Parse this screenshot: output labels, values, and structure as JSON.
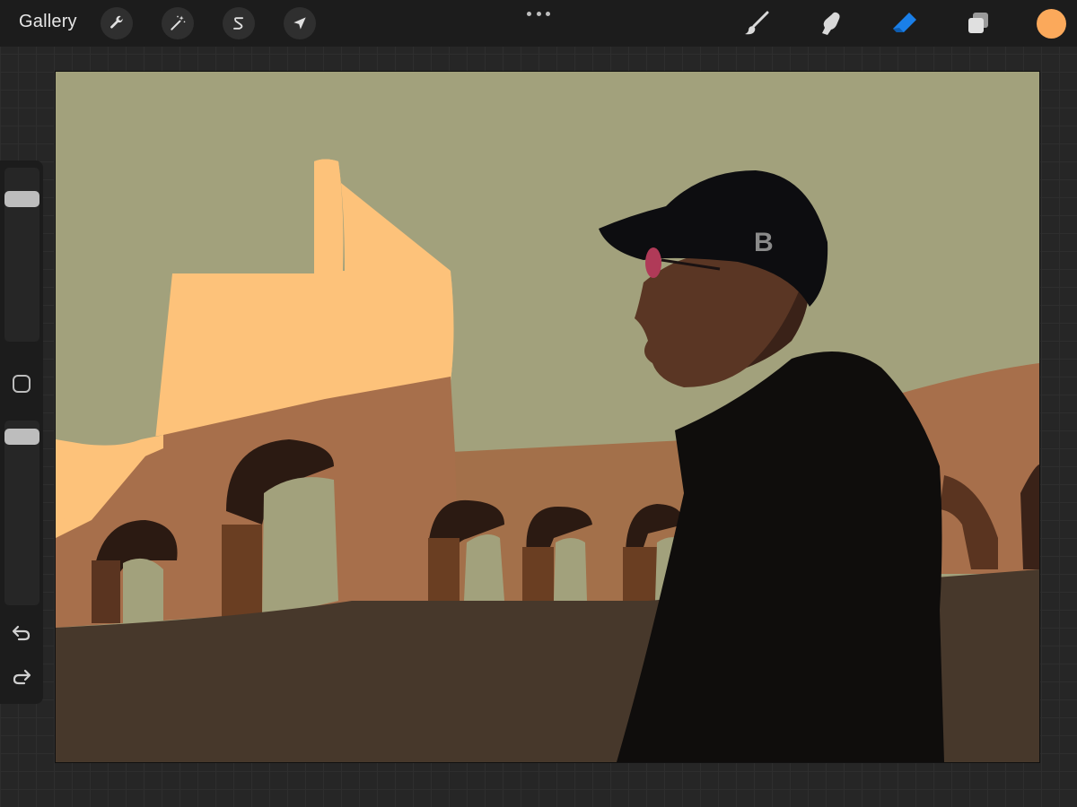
{
  "topbar": {
    "gallery_label": "Gallery",
    "left_tools": [
      {
        "icon": "wrench-icon",
        "name": "actions"
      },
      {
        "icon": "magic-wand-icon",
        "name": "adjustments"
      },
      {
        "icon": "selection-s-icon",
        "name": "selection"
      },
      {
        "icon": "arrow-cursor-icon",
        "name": "transform"
      }
    ],
    "right_tools": [
      {
        "icon": "brush-icon",
        "name": "paint"
      },
      {
        "icon": "smudge-finger-icon",
        "name": "smudge"
      },
      {
        "icon": "eraser-icon",
        "name": "erase",
        "active": true
      },
      {
        "icon": "layers-icon",
        "name": "layers"
      }
    ],
    "current_color": "#FBA95B"
  },
  "sidebar": {
    "brush_size_level": 0.85,
    "opacity_level": 0.95,
    "icons": [
      "square-icon",
      "undo-icon",
      "redo-icon"
    ]
  },
  "canvas": {
    "description_colors": {
      "sky": "#A2A17C",
      "building_light": "#FDC27A",
      "building_mid": "#A76F4B",
      "arch_dark": "#2B1A12",
      "ground": "#47382B",
      "figure": "#0F0D0C",
      "accent_active": "#1A7FE8"
    }
  }
}
